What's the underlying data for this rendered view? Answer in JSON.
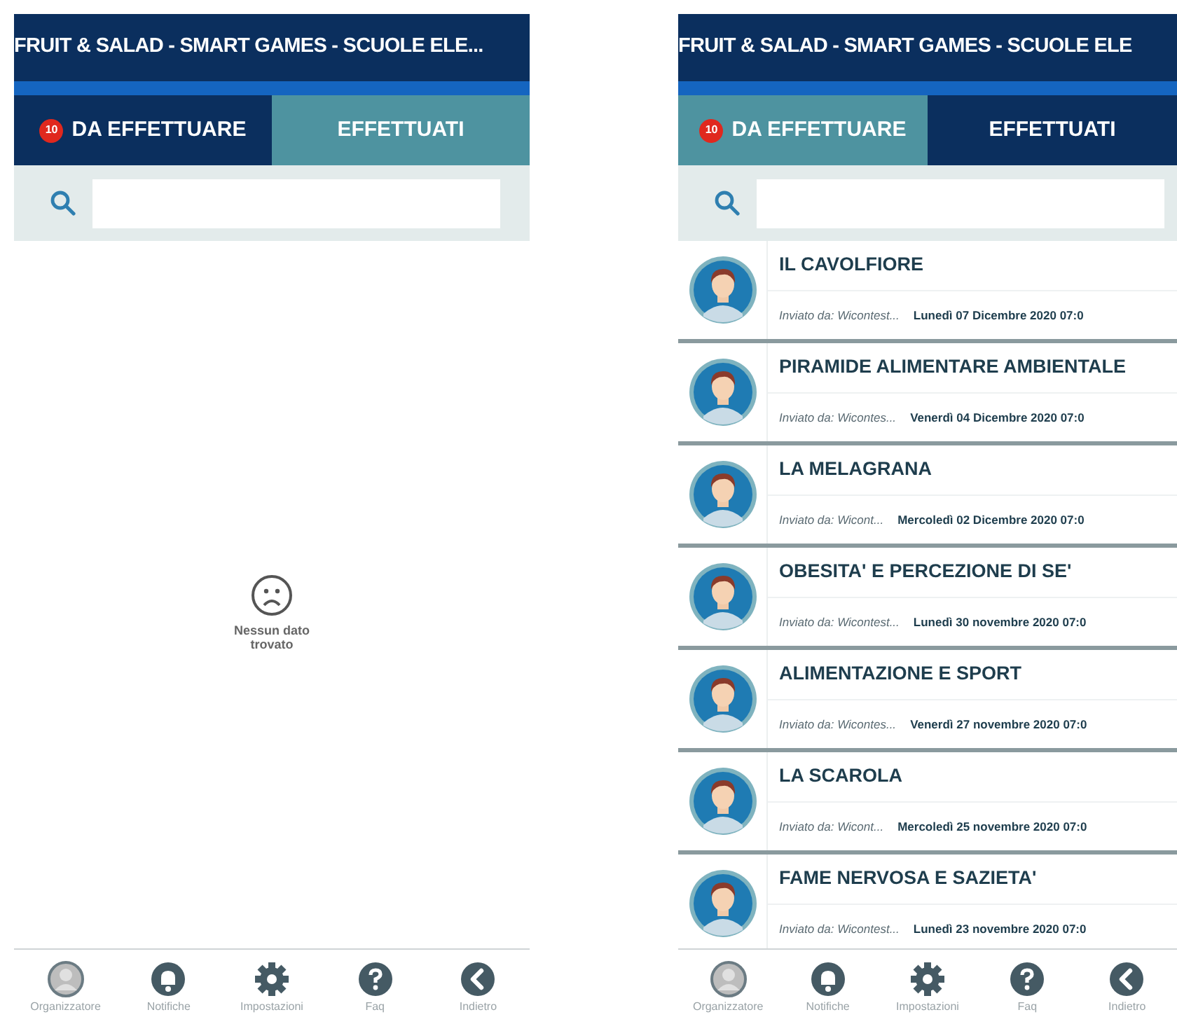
{
  "screens": [
    {
      "title": "FRUIT & SALAD - SMART GAMES - SCUOLE ELE...",
      "tabs": [
        {
          "label": "DA EFFETTUARE",
          "badge": "10",
          "selected": false
        },
        {
          "label": "EFFETTUATI",
          "selected": true
        }
      ],
      "empty_message": "Nessun dato trovato",
      "nav": [
        "Organizzatore",
        "Notifiche",
        "Impostazioni",
        "Faq",
        "Indietro"
      ]
    },
    {
      "title": "FRUIT & SALAD - SMART GAMES - SCUOLE ELE",
      "tabs": [
        {
          "label": "DA EFFETTUARE",
          "badge": "10",
          "selected": true
        },
        {
          "label": "EFFETTUATI",
          "selected": false
        }
      ],
      "items": [
        {
          "title": "IL CAVOLFIORE",
          "sender": "Inviato da: Wicontest...",
          "date": "Lunedì 07 Dicembre 2020 07:0"
        },
        {
          "title": "PIRAMIDE ALIMENTARE AMBIENTALE",
          "sender": "Inviato da: Wicontes...",
          "date": "Venerdì 04 Dicembre 2020 07:0"
        },
        {
          "title": "LA MELAGRANA",
          "sender": "Inviato da: Wicont...",
          "date": "Mercoledì 02 Dicembre 2020 07:0"
        },
        {
          "title": "OBESITA' E PERCEZIONE DI SE'",
          "sender": "Inviato da: Wicontest...",
          "date": "Lunedì 30 novembre 2020 07:0"
        },
        {
          "title": "ALIMENTAZIONE E SPORT",
          "sender": "Inviato da: Wicontes...",
          "date": "Venerdì 27 novembre 2020 07:0"
        },
        {
          "title": "LA SCAROLA",
          "sender": "Inviato da: Wicont...",
          "date": "Mercoledì 25 novembre 2020 07:0"
        },
        {
          "title": "FAME NERVOSA E SAZIETA'",
          "sender": "Inviato da: Wicontest...",
          "date": "Lunedì 23 novembre 2020 07:0"
        }
      ],
      "nav": [
        "Organizzatore",
        "Notifiche",
        "Impostazioni",
        "Faq",
        "Indietro"
      ]
    }
  ]
}
